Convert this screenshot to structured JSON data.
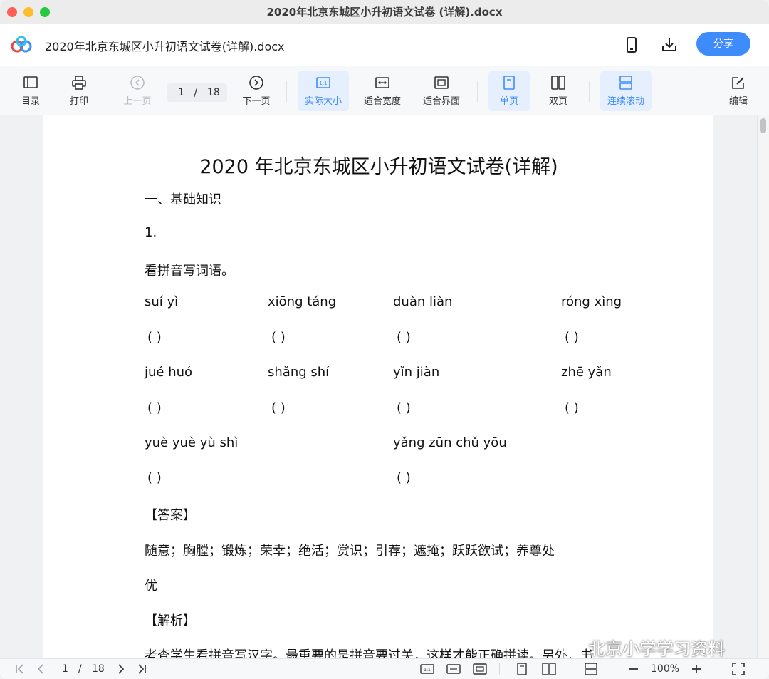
{
  "window": {
    "title": "2020年北京东城区小升初语文试卷 (详解).docx"
  },
  "header": {
    "document_name": "2020年北京东城区小升初语文试卷(详解).docx",
    "share_label": "分享"
  },
  "toolbar": {
    "toc": "目录",
    "print": "打印",
    "prev_page": "上一页",
    "current_page": "1",
    "page_separator": "/",
    "total_pages": "18",
    "next_page": "下一页",
    "actual_size": "实际大小",
    "fit_width": "适合宽度",
    "fit_screen": "适合界面",
    "single_page": "单页",
    "double_page": "双页",
    "continuous_scroll": "连续滚动",
    "edit": "编辑"
  },
  "document": {
    "title": "2020 年北京东城区小升初语文试卷(详解)",
    "section1": "一、基础知识",
    "q1": "1.",
    "instruction": "看拼音写词语。",
    "row1": [
      "suí  yì",
      "xiōng táng",
      "duàn liàn",
      "róng xìng"
    ],
    "row2": [
      "jué  huó",
      "shǎng shí",
      "yǐn jiàn",
      "zhē  yǎn"
    ],
    "row3": [
      "yuè  yuè  yù  shì",
      "yǎng zūn chǔ  yōu"
    ],
    "blank_short": "(            )",
    "blank_long": "(                    )",
    "blank_longer": "(                              )",
    "answer_label": "【答案】",
    "answer_line1": "随意；胸膛；锻炼；荣幸；绝活；赏识；引荐；遮掩；跃跃欲试；养尊处",
    "answer_line2": "优",
    "analysis_label": "【解析】",
    "analysis_line1": "考查学生看拼音写汉字。最重要的是拼音要过关，这样才能正确拼读。另外，书"
  },
  "watermark": {
    "text": "北京小学学习资料"
  },
  "statusbar": {
    "current_page": "1",
    "separator": "/",
    "total_pages": "18",
    "zoom": "100%"
  },
  "colors": {
    "accent": "#3e8cfb",
    "active_bg": "#e6effd"
  }
}
